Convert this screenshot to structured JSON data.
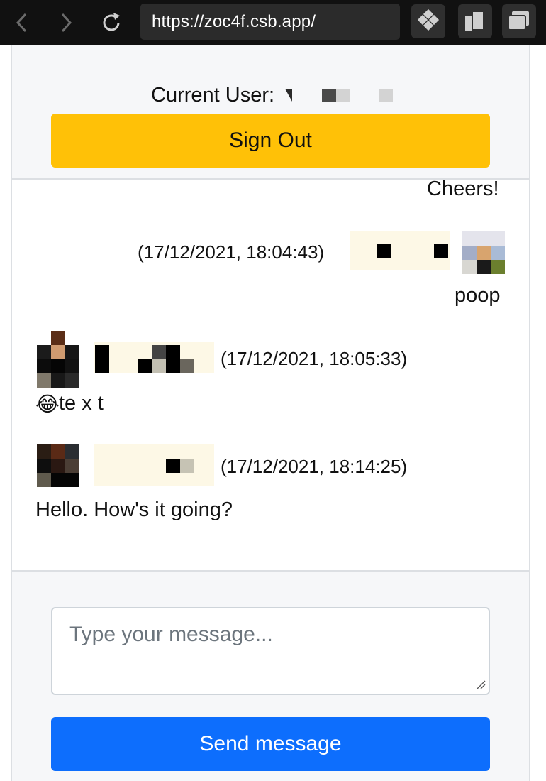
{
  "browser": {
    "url": "https://zoc4f.csb.app/",
    "back_icon": "chevron-left-icon",
    "forward_icon": "chevron-right-icon",
    "reload_icon": "reload-icon"
  },
  "header": {
    "current_user_label": "Current User:",
    "sign_out_label": "Sign Out",
    "sign_out_color": "#ffc107"
  },
  "messages": [
    {
      "side": "right",
      "text": "Cheers!"
    },
    {
      "side": "right",
      "timestamp": "(17/12/2021, 18:04:43)",
      "text": "poop"
    },
    {
      "side": "left",
      "timestamp": "(17/12/2021, 18:05:33)",
      "emoji": "😂",
      "text": "te x t"
    },
    {
      "side": "left",
      "timestamp": "(17/12/2021, 18:14:25)",
      "text": "Hello. How's it going?"
    }
  ],
  "composer": {
    "placeholder": "Type your message...",
    "value": "",
    "send_label": "Send message",
    "send_color": "#0d6efd"
  }
}
